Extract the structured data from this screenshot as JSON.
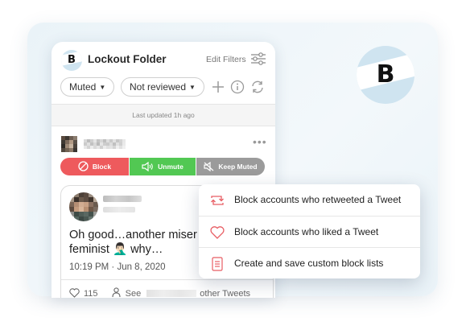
{
  "app": {
    "logo_letter": "B",
    "folder_title": "Lockout Folder",
    "edit_filters_label": "Edit Filters"
  },
  "filters": {
    "status_value": "Muted",
    "review_value": "Not reviewed"
  },
  "last_updated": "Last updated 1h ago",
  "actions": {
    "block_label": "Block",
    "unmute_label": "Unmute",
    "keep_muted_label": "Keep Muted"
  },
  "tweet": {
    "text_line1": "Oh good…another miser",
    "text_line2": "feminist 🤦🏻‍♂️ why…",
    "time": "10:19 PM · Jun 8, 2020",
    "like_count": "115",
    "see_label": "See",
    "other_tweets_label": "other Tweets"
  },
  "popup_menu": {
    "items": [
      {
        "label": "Block accounts who retweeted a Tweet",
        "icon": "retweet-icon"
      },
      {
        "label": "Block accounts who liked a Tweet",
        "icon": "heart-icon"
      },
      {
        "label": "Create and save custom block lists",
        "icon": "list-icon"
      }
    ]
  },
  "colors": {
    "block": "#ee5a5d",
    "unmute": "#52c853",
    "keep_muted": "#9b9b9b",
    "accent_icon": "#e85d63",
    "logo_bg": "#cfe4f0"
  }
}
